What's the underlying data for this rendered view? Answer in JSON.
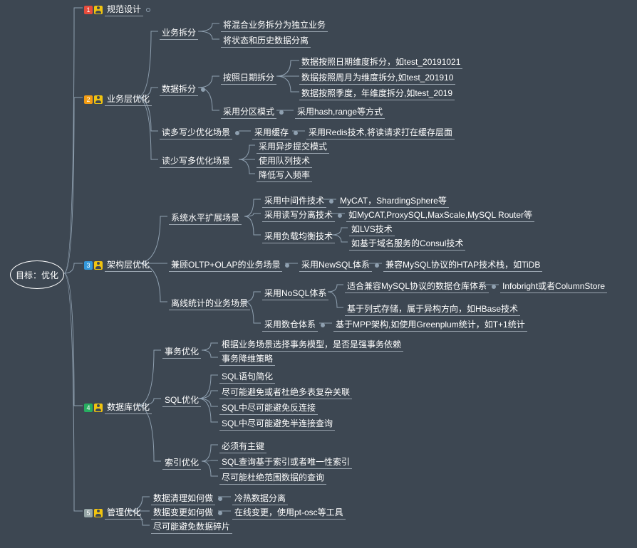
{
  "root": "目标：优化",
  "l1": {
    "n": "1",
    "t": "规范设计"
  },
  "l2": {
    "n": "2",
    "t": "业务层优化",
    "c1": {
      "t": "业务拆分",
      "s1": "将混合业务拆分为独立业务",
      "s2": "将状态和历史数据分离"
    },
    "c2": {
      "t": "数据拆分",
      "a": {
        "t": "按照日期拆分",
        "s1": "数据按照日期维度拆分，如test_20191021",
        "s2": "数据按照周月为维度拆分,如test_201910",
        "s3": "数据按照季度，年维度拆分,如test_2019"
      },
      "b": {
        "t": "采用分区模式",
        "s": "采用hash,range等方式"
      }
    },
    "c3": {
      "t": "读多写少优化场景",
      "m": "采用缓存",
      "s": "采用Redis技术,将读请求打在缓存层面"
    },
    "c4": {
      "t": "读少写多优化场景",
      "s1": "采用异步提交模式",
      "s2": "使用队列技术",
      "s3": "降低写入频率"
    }
  },
  "l3": {
    "n": "3",
    "t": "架构层优化",
    "c1": {
      "t": "系统水平扩展场景",
      "a": {
        "t": "采用中间件技术",
        "s": "MyCAT，ShardingSphere等"
      },
      "b": {
        "t": "采用读写分离技术",
        "s": "如MyCAT,ProxySQL,MaxScale,MySQL Router等"
      },
      "c": {
        "t": "采用负载均衡技术",
        "s1": "如LVS技术",
        "s2": "如基于域名服务的Consul技术"
      }
    },
    "c2": {
      "t": "兼顾OLTP+OLAP的业务场景",
      "m": "采用NewSQL体系",
      "s": "兼容MySQL协议的HTAP技术栈，如TiDB"
    },
    "c3": {
      "t": "离线统计的业务场景",
      "a": {
        "t": "采用NoSQL体系",
        "s1t": "适合兼容MySQL协议的数据仓库体系",
        "s1s": "Infobright或者ColumnStore",
        "s2": "基于列式存储，属于异构方向，如HBase技术"
      },
      "b": {
        "t": "采用数仓体系",
        "s": "基于MPP架构,如使用Greenplum统计，如T+1统计"
      }
    }
  },
  "l4": {
    "n": "4",
    "t": "数据库优化",
    "c1": {
      "t": "事务优化",
      "s1": "根据业务场景选择事务模型，是否是强事务依赖",
      "s2": "事务降维策略"
    },
    "c2": {
      "t": "SQL优化",
      "s1": "SQL语句简化",
      "s2": "尽可能避免或者杜绝多表复杂关联",
      "s3": "SQL中尽可能避免反连接",
      "s4": "SQL中尽可能避免半连接查询"
    },
    "c3": {
      "t": "索引优化",
      "s1": "必须有主键",
      "s2": "SQL查询基于索引或者唯一性索引",
      "s3": "尽可能杜绝范围数据的查询"
    }
  },
  "l5": {
    "n": "5",
    "t": "管理优化",
    "c1": {
      "t": "数据清理如何做",
      "s": "冷热数据分离"
    },
    "c2": {
      "t": "数据变更如何做",
      "s": "在线变更，使用pt-osc等工具"
    },
    "c3": {
      "t": "尽可能避免数据碎片"
    }
  }
}
